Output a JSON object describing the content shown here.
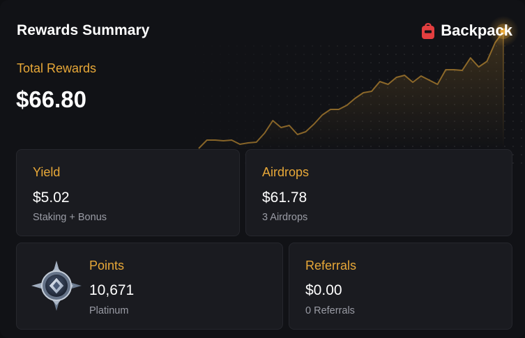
{
  "header": {
    "title": "Rewards Summary",
    "brand_name": "Backpack",
    "brand_icon": "backpack-logo-icon",
    "brand_color": "#e33e3f"
  },
  "total": {
    "label": "Total Rewards",
    "value": "$66.80"
  },
  "accent_color": "#e8a838",
  "chart_data": {
    "type": "line",
    "title": "",
    "xlabel": "",
    "ylabel": "",
    "values": [
      0,
      12,
      12,
      11,
      12,
      6,
      8,
      9,
      22,
      40,
      30,
      33,
      20,
      24,
      35,
      48,
      56,
      56,
      62,
      72,
      80,
      82,
      96,
      92,
      102,
      105,
      95,
      104,
      98,
      92,
      113,
      113,
      112,
      130,
      117,
      125,
      152,
      168
    ],
    "grid": false,
    "legend": "none"
  },
  "panels": {
    "yield": {
      "label": "Yield",
      "value": "$5.02",
      "sub": "Staking + Bonus"
    },
    "airdrops": {
      "label": "Airdrops",
      "value": "$61.78",
      "sub": "3 Airdrops"
    },
    "points": {
      "label": "Points",
      "value": "10,671",
      "sub": "Platinum",
      "badge_icon": "platinum-badge-icon"
    },
    "referrals": {
      "label": "Referrals",
      "value": "$0.00",
      "sub": "0 Referrals"
    }
  }
}
